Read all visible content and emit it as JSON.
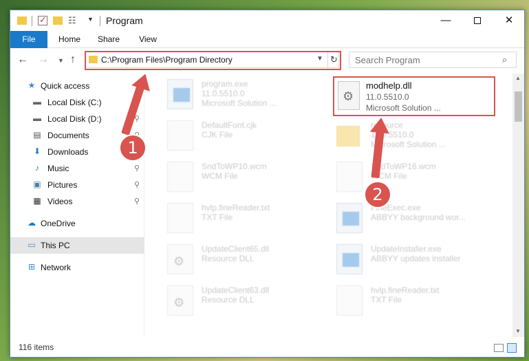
{
  "window": {
    "title": "Program"
  },
  "ribbon": {
    "tabs": [
      "File",
      "Home",
      "Share",
      "View"
    ]
  },
  "address": {
    "path": "C:\\Program Files\\Program Directory"
  },
  "search": {
    "placeholder": "Search Program"
  },
  "sidebar": {
    "items": [
      {
        "label": "Quick access",
        "icon": "star-icon",
        "pinned": false
      },
      {
        "label": "Local Disk (C:)",
        "icon": "drive-icon",
        "pinned": true
      },
      {
        "label": "Local Disk (D:)",
        "icon": "drive-icon",
        "pinned": true
      },
      {
        "label": "Documents",
        "icon": "documents-icon",
        "pinned": true
      },
      {
        "label": "Downloads",
        "icon": "download-icon",
        "pinned": true
      },
      {
        "label": "Music",
        "icon": "music-icon",
        "pinned": true
      },
      {
        "label": "Pictures",
        "icon": "pictures-icon",
        "pinned": true
      },
      {
        "label": "Videos",
        "icon": "videos-icon",
        "pinned": true
      },
      {
        "label": "OneDrive",
        "icon": "cloud-icon",
        "pinned": false
      },
      {
        "label": "This PC",
        "icon": "computer-icon",
        "pinned": false,
        "selected": true
      },
      {
        "label": "Network",
        "icon": "network-icon",
        "pinned": false
      }
    ]
  },
  "files": [
    {
      "name": "program.exe",
      "line2": "11.0.5510.0",
      "line3": "Microsoft Solution ...",
      "icon": "exe"
    },
    {
      "name": "DefaultFont.cjk",
      "line2": "CJK File",
      "line3": "",
      "icon": "doc"
    },
    {
      "name": "resource",
      "line2": "11.0.5510.0",
      "line3": "Microsoft Solution ...",
      "icon": "folder"
    },
    {
      "name": "SndToWP10.wcm",
      "line2": "WCM File",
      "line3": "",
      "icon": "doc"
    },
    {
      "name": "SndToWP16.wcm",
      "line2": "WCM File",
      "line3": "",
      "icon": "doc"
    },
    {
      "name": "hvlp.fineReader.txt",
      "line2": "TXT File",
      "line3": "",
      "icon": "doc"
    },
    {
      "name": "FineExec.exe",
      "line2": "ABBYY background wor...",
      "line3": "",
      "icon": "exe"
    },
    {
      "name": "UpdateClient65.dll",
      "line2": "Resource DLL",
      "line3": "",
      "icon": "gear"
    },
    {
      "name": "UpdateInstaller.exe",
      "line2": "ABBYY updates installer",
      "line3": "",
      "icon": "exe"
    },
    {
      "name": "UpdateClient63.dll",
      "line2": "Resource DLL",
      "line3": "",
      "icon": "gear"
    },
    {
      "name": "hvlp.fineReader.txt",
      "line2": "TXT File",
      "line3": "",
      "icon": "doc"
    }
  ],
  "selected_file": {
    "name": "modhelp.dll",
    "version": "11.0.5510.0",
    "description": "Microsoft Solution ..."
  },
  "status": {
    "count": "116 items"
  },
  "annotations": {
    "step1": "1",
    "step2": "2"
  },
  "colors": {
    "accent": "#1979ca",
    "annotation": "#d9534f",
    "folder": "#f2c94c"
  }
}
